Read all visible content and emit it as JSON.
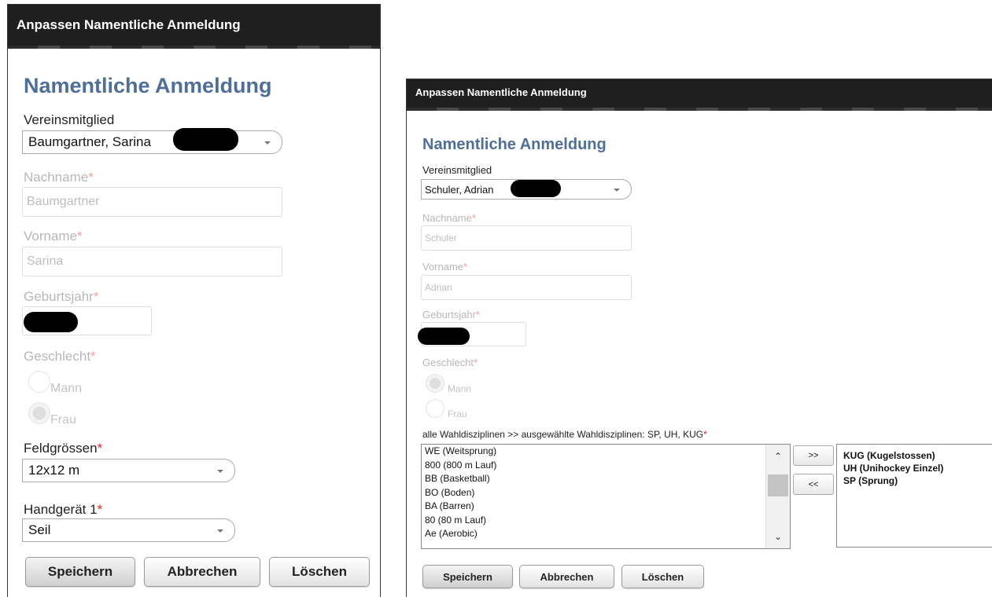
{
  "left": {
    "title": "Anpassen Namentliche Anmeldung",
    "heading": "Namentliche Anmeldung",
    "member_label": "Vereinsmitglied",
    "member_value": "Baumgartner, Sarina",
    "lastname_label": "Nachname",
    "lastname_value": "Baumgartner",
    "firstname_label": "Vorname",
    "firstname_value": "Sarina",
    "birthyear_label": "Geburtsjahr",
    "gender_label": "Geschlecht",
    "gender_options": [
      "Mann",
      "Frau"
    ],
    "gender_selected": "Frau",
    "fieldsize_label": "Feldgrössen",
    "fieldsize_value": "12x12 m",
    "equipment_label": "Handgerät 1",
    "equipment_value": "Seil",
    "buttons": {
      "save": "Speichern",
      "cancel": "Abbrechen",
      "delete": "Löschen"
    }
  },
  "right": {
    "title": "Anpassen Namentliche Anmeldung",
    "heading": "Namentliche Anmeldung",
    "member_label": "Vereinsmitglied",
    "member_value": "Schuler, Adrian",
    "lastname_label": "Nachname",
    "lastname_value": "Schuler",
    "firstname_label": "Vorname",
    "firstname_value": "Adrian",
    "birthyear_label": "Geburtsjahr",
    "gender_label": "Geschlecht",
    "gender_options": [
      "Mann",
      "Frau"
    ],
    "gender_selected": "Mann",
    "disciplines_label": "alle Wahldisziplinen >> ausgewählte Wahldisziplinen: SP, UH, KUG",
    "available_disciplines": [
      "WE (Weitsprung)",
      "800 (800 m Lauf)",
      "BB (Basketball)",
      "BO (Boden)",
      "BA (Barren)",
      "80 (80 m Lauf)",
      "Ae (Aerobic)"
    ],
    "selected_disciplines": [
      "KUG (Kugelstossen)",
      "UH (Unihockey Einzel)",
      "SP (Sprung)"
    ],
    "add_button": ">>",
    "remove_button": "<<",
    "buttons": {
      "save": "Speichern",
      "cancel": "Abbrechen",
      "delete": "Löschen"
    }
  },
  "colors": {
    "heading": "#4f6f96",
    "titlebar": "#1f1f1f",
    "required": "#e02020"
  },
  "icons": {
    "dropdown": "chevron-down-icon",
    "scroll_up": "chevron-up-icon",
    "scroll_down": "chevron-down-icon"
  }
}
